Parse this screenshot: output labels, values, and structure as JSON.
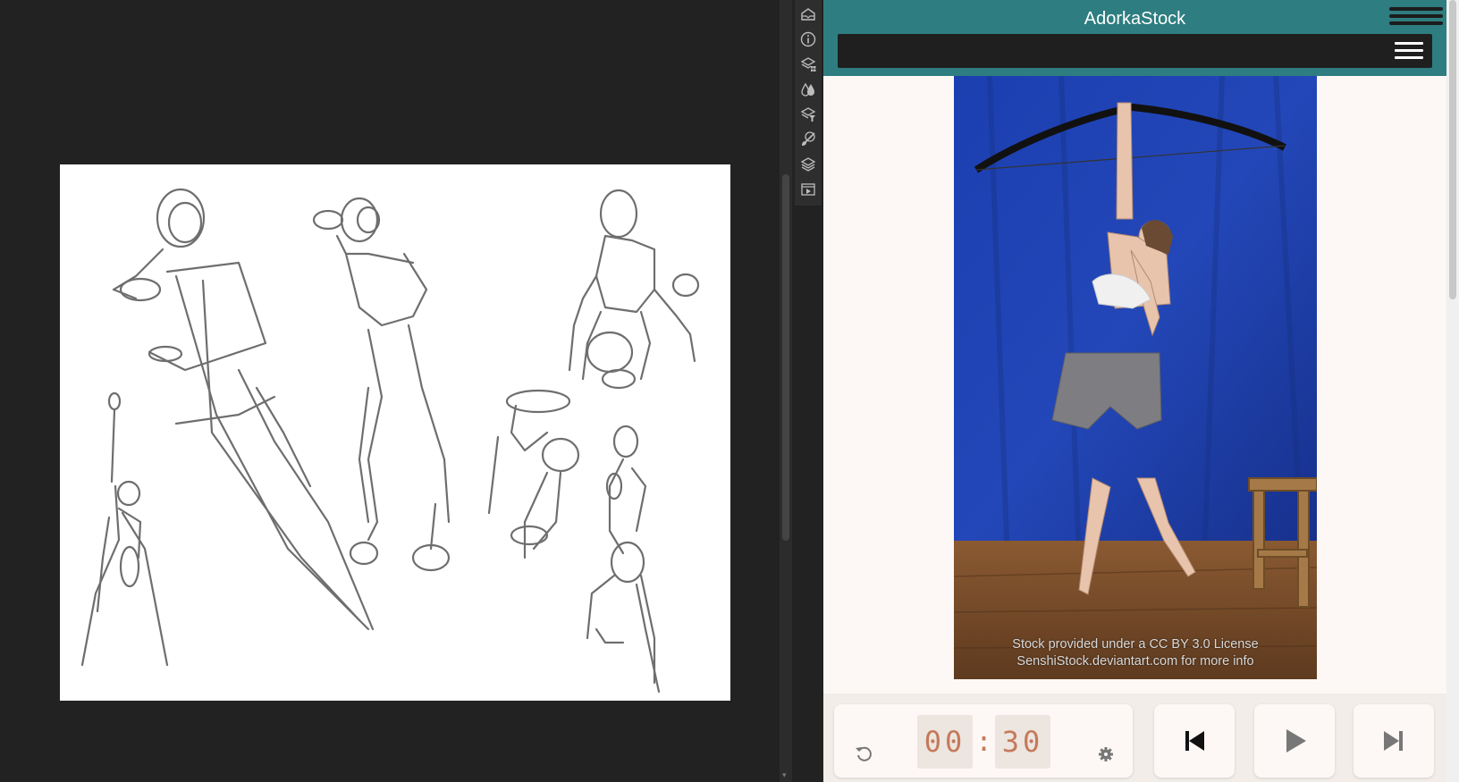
{
  "app": {
    "title": "AdorkaStock"
  },
  "toolbar": {
    "icons": [
      "navigator-icon",
      "info-icon",
      "layer-comps-icon",
      "color-swatches-icon",
      "layer-filter-icon",
      "brush-icon",
      "layers-icon",
      "timeline-icon"
    ]
  },
  "photo": {
    "credit_line1": "Stock provided under a CC BY 3.0 License",
    "credit_line2": "SenshiStock.deviantart.com for more info"
  },
  "timer": {
    "minutes": "00",
    "separator": ":",
    "seconds": "30"
  },
  "colors": {
    "header": "#2e7d80",
    "navbar": "#1f1f1f",
    "panel_bg": "#fdf8f5",
    "timer_digits": "#c47a5a",
    "canvas_bg": "#222222",
    "backdrop_blue": "#1f3da8"
  }
}
